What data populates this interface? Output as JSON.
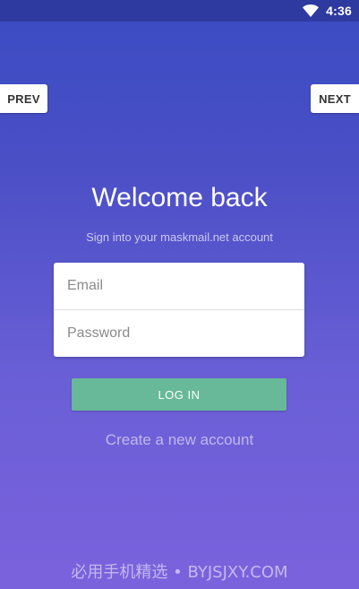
{
  "status_bar": {
    "time": "4:36",
    "wifi_icon": "wifi-icon"
  },
  "nav": {
    "prev_label": "PREV",
    "next_label": "NEXT"
  },
  "login": {
    "title": "Welcome back",
    "subtitle": "Sign into your maskmail.net account",
    "email_placeholder": "Email",
    "password_placeholder": "Password",
    "login_label": "LOG IN",
    "create_account_label": "Create a new account"
  },
  "watermark": "必用手机精选 • BYJSJXY.COM",
  "colors": {
    "background_top": "#3a4cc2",
    "background_bottom": "#7b62dd",
    "login_button": "#68b999",
    "status_bar": "#2e3aa0"
  }
}
